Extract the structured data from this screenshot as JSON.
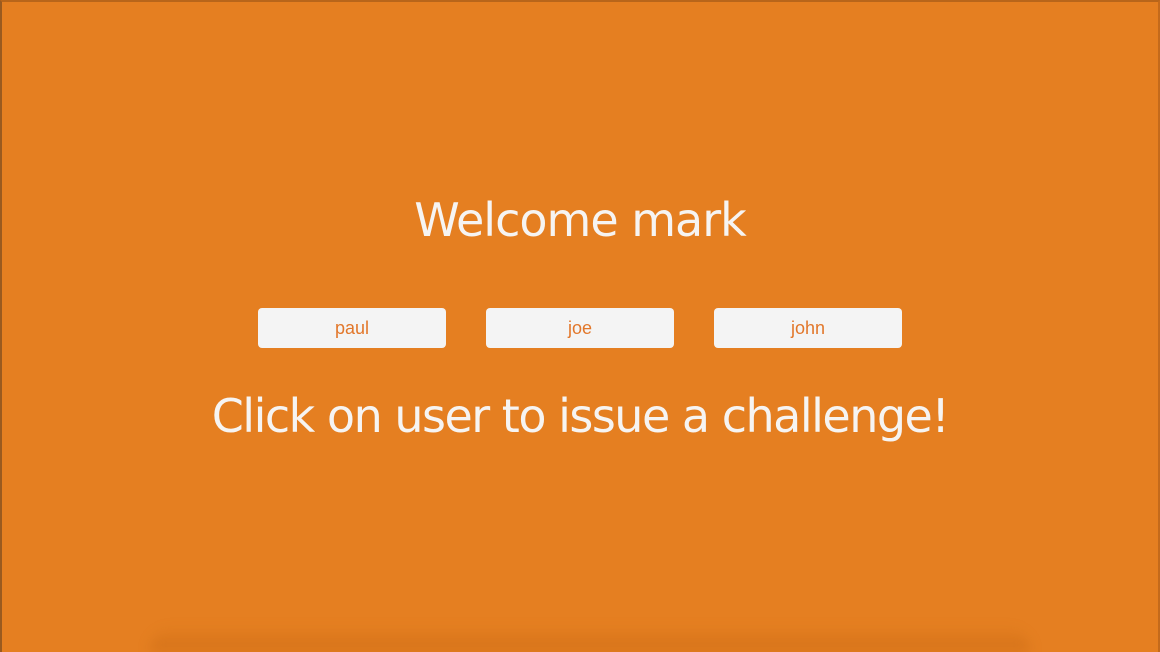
{
  "header": {
    "welcome_text": "Welcome mark"
  },
  "users": [
    {
      "label": "paul"
    },
    {
      "label": "joe"
    },
    {
      "label": "john"
    }
  ],
  "instruction": {
    "text": "Click on user to issue a challenge!"
  },
  "colors": {
    "background": "#e57f21",
    "button_bg": "#f4f4f4",
    "button_text": "#e2772a",
    "heading_text": "#f6f4f2"
  }
}
